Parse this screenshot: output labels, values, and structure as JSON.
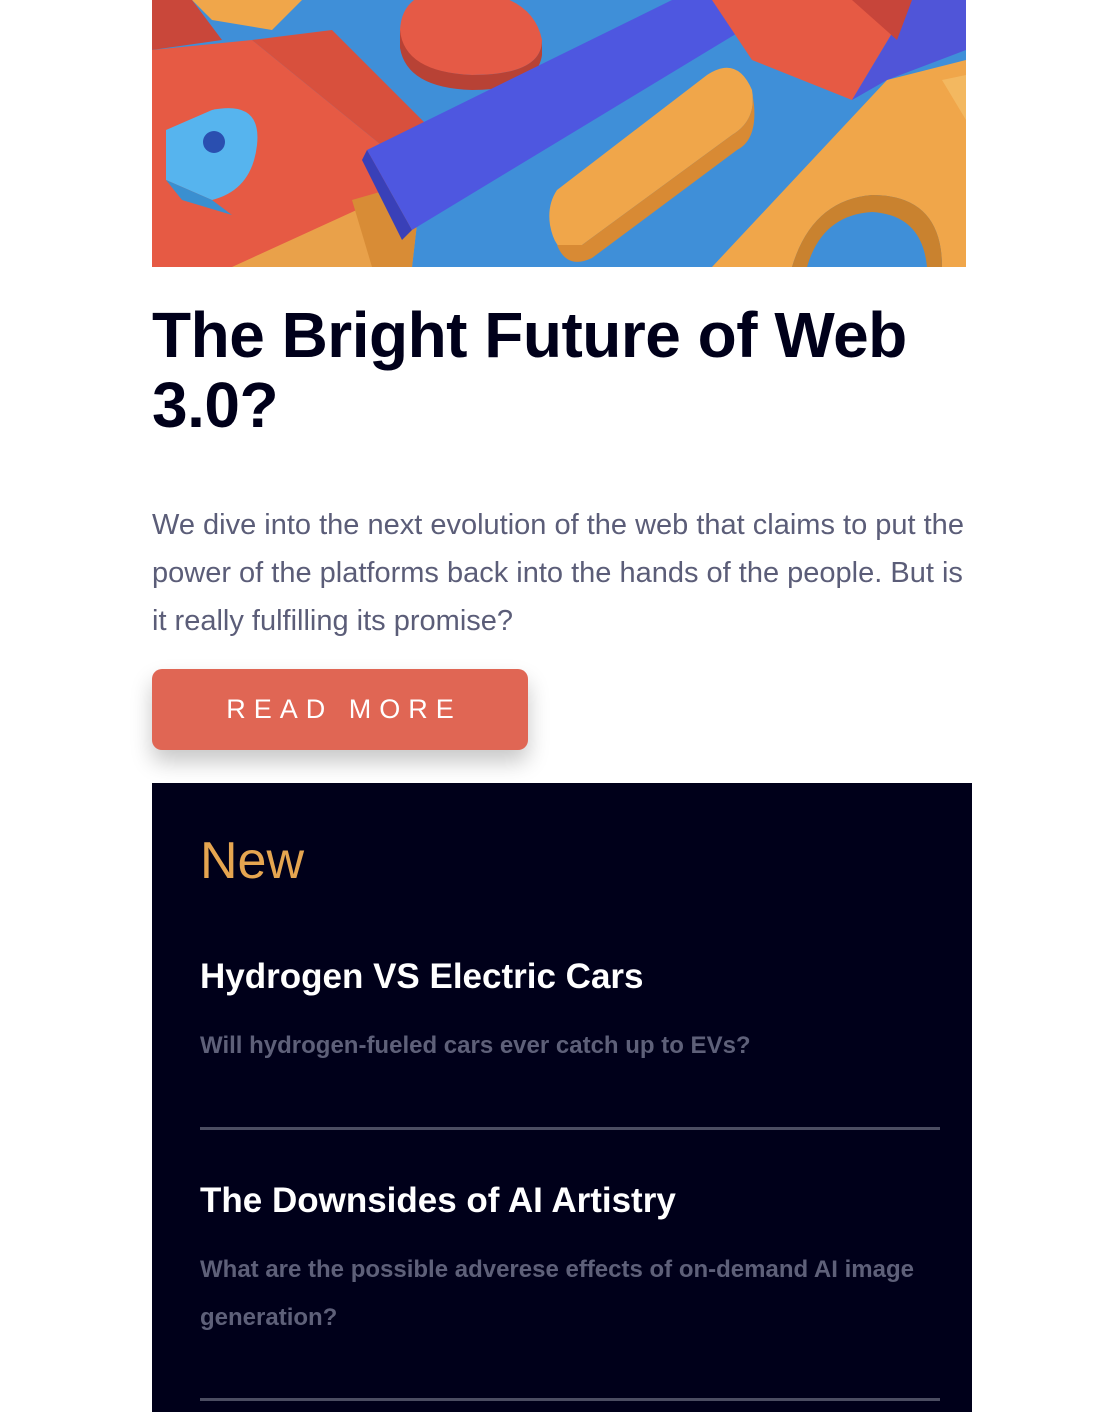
{
  "article": {
    "image_alt": "Colorful 3D geometric shapes",
    "title": "The Bright Future of Web 3.0?",
    "excerpt": "We dive into the next evolution of the web that claims to put the power of the platforms back into the hands of the people. But is it really fulfilling its promise?",
    "read_more_label": "READ MORE"
  },
  "new_section": {
    "heading": "New",
    "items": [
      {
        "title": "Hydrogen VS Electric Cars",
        "description": "Will hydrogen-fueled cars ever catch up to EVs?"
      },
      {
        "title": "The Downsides of AI Artistry",
        "description": "What are the possible adverese effects of on-demand AI image generation?"
      }
    ]
  },
  "colors": {
    "accent_button": "#e06654",
    "new_heading": "#e5a550",
    "panel_background": "#00001a",
    "headline": "#00001a",
    "body_text": "#5b5d78"
  }
}
